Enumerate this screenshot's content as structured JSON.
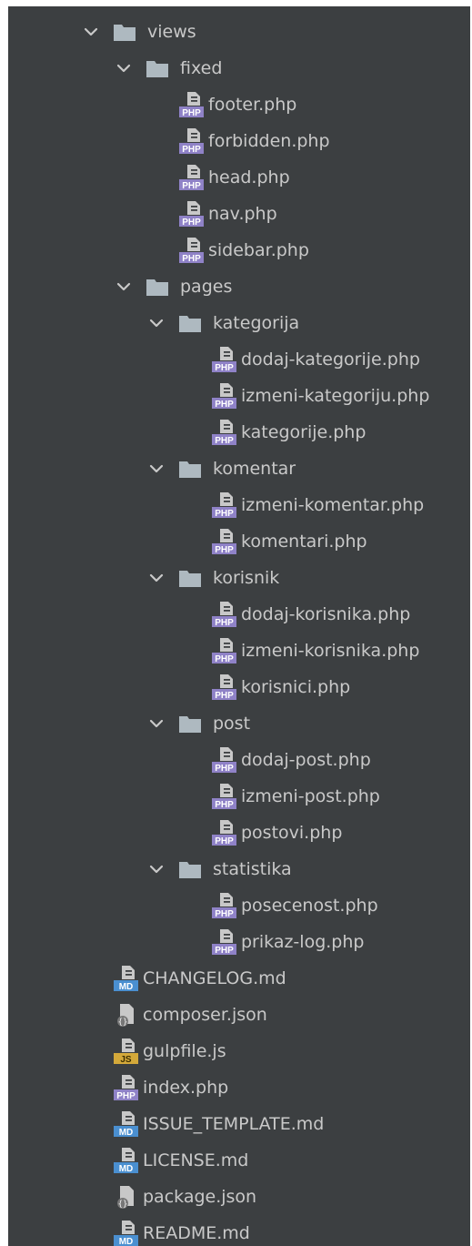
{
  "tree": [
    {
      "label": "views",
      "type": "folder",
      "expanded": true,
      "depth": 0
    },
    {
      "label": "fixed",
      "type": "folder",
      "expanded": true,
      "depth": 1
    },
    {
      "label": "footer.php",
      "type": "php",
      "depth": 2
    },
    {
      "label": "forbidden.php",
      "type": "php",
      "depth": 2
    },
    {
      "label": "head.php",
      "type": "php",
      "depth": 2
    },
    {
      "label": "nav.php",
      "type": "php",
      "depth": 2
    },
    {
      "label": "sidebar.php",
      "type": "php",
      "depth": 2
    },
    {
      "label": "pages",
      "type": "folder",
      "expanded": true,
      "depth": 1
    },
    {
      "label": "kategorija",
      "type": "folder",
      "expanded": true,
      "depth": 2
    },
    {
      "label": "dodaj-kategorije.php",
      "type": "php",
      "depth": 3
    },
    {
      "label": "izmeni-kategoriju.php",
      "type": "php",
      "depth": 3
    },
    {
      "label": "kategorije.php",
      "type": "php",
      "depth": 3
    },
    {
      "label": "komentar",
      "type": "folder",
      "expanded": true,
      "depth": 2
    },
    {
      "label": "izmeni-komentar.php",
      "type": "php",
      "depth": 3
    },
    {
      "label": "komentari.php",
      "type": "php",
      "depth": 3
    },
    {
      "label": "korisnik",
      "type": "folder",
      "expanded": true,
      "depth": 2
    },
    {
      "label": "dodaj-korisnika.php",
      "type": "php",
      "depth": 3
    },
    {
      "label": "izmeni-korisnika.php",
      "type": "php",
      "depth": 3
    },
    {
      "label": "korisnici.php",
      "type": "php",
      "depth": 3
    },
    {
      "label": "post",
      "type": "folder",
      "expanded": true,
      "depth": 2
    },
    {
      "label": "dodaj-post.php",
      "type": "php",
      "depth": 3
    },
    {
      "label": "izmeni-post.php",
      "type": "php",
      "depth": 3
    },
    {
      "label": "postovi.php",
      "type": "php",
      "depth": 3
    },
    {
      "label": "statistika",
      "type": "folder",
      "expanded": true,
      "depth": 2
    },
    {
      "label": "posecenost.php",
      "type": "php",
      "depth": 3
    },
    {
      "label": "prikaz-log.php",
      "type": "php",
      "depth": 3
    },
    {
      "label": "CHANGELOG.md",
      "type": "md",
      "depth": 0
    },
    {
      "label": "composer.json",
      "type": "json",
      "depth": 0
    },
    {
      "label": "gulpfile.js",
      "type": "js",
      "depth": 0
    },
    {
      "label": "index.php",
      "type": "php",
      "depth": 0
    },
    {
      "label": "ISSUE_TEMPLATE.md",
      "type": "md",
      "depth": 0
    },
    {
      "label": "LICENSE.md",
      "type": "md",
      "depth": 0
    },
    {
      "label": "package.json",
      "type": "json",
      "depth": 0
    },
    {
      "label": "README.md",
      "type": "md",
      "depth": 0
    }
  ],
  "badges": {
    "php": "PHP",
    "md": "MD",
    "js": "JS"
  },
  "icons": {
    "chevron": "chevron-down-icon",
    "folder": "folder-icon",
    "php": "php-file-icon",
    "md": "markdown-file-icon",
    "js": "javascript-file-icon",
    "json": "json-file-icon"
  },
  "colors": {
    "background": "#3c3f41",
    "text": "#c9c9c9",
    "folder": "#aeb9c0",
    "php_badge": "#8f82c7",
    "md_badge": "#4a8fd0",
    "js_badge": "#d4a93a",
    "json_badge": "#aaaaaa"
  }
}
